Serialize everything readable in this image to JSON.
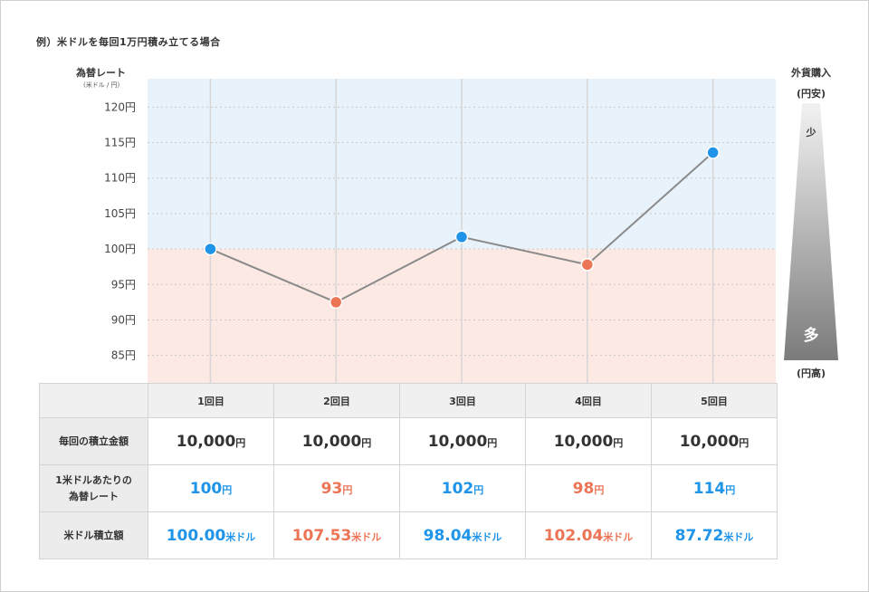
{
  "title": "例）米ドルを毎回1万円積み立てる場合",
  "y_axis": {
    "label": "為替レート",
    "unit": "(米ドル / 円)"
  },
  "meter": {
    "title": "外貨購入",
    "top_label": "(円安)",
    "bottom_label": "(円高)",
    "small_word": "少",
    "big_word": "多"
  },
  "colors": {
    "blue": "#1f94e8",
    "red": "#ec7556",
    "band_blue": "#e8f2fb",
    "band_red": "#fce9e3",
    "line": "#8a8a8a"
  },
  "chart_data": {
    "type": "line",
    "x": [
      "1回目",
      "2回目",
      "3回目",
      "4回目",
      "5回目"
    ],
    "series": [
      {
        "values": [
          100,
          92.5,
          101.7,
          97.8,
          113.6
        ]
      }
    ],
    "y_ticks": [
      "120円",
      "115円",
      "110円",
      "105円",
      "100円",
      "95円",
      "90円",
      "85円"
    ],
    "ylim": [
      81,
      124
    ],
    "threshold": 100,
    "point_colors": [
      "blue",
      "red",
      "blue",
      "red",
      "blue"
    ],
    "grid": true,
    "xlabel": "",
    "ylabel": "為替レート"
  },
  "table": {
    "columns": [
      "1回目",
      "2回目",
      "3回目",
      "4回目",
      "5回目"
    ],
    "rows": [
      {
        "label_lines": [
          "毎回の積立金額"
        ],
        "cells": [
          {
            "value": "10,000",
            "unit": "円"
          },
          {
            "value": "10,000",
            "unit": "円"
          },
          {
            "value": "10,000",
            "unit": "円"
          },
          {
            "value": "10,000",
            "unit": "円"
          },
          {
            "value": "10,000",
            "unit": "円"
          }
        ]
      },
      {
        "label_lines": [
          "1米ドルあたりの",
          "為替レート"
        ],
        "cells": [
          {
            "value": "100",
            "unit": "円"
          },
          {
            "value": "93",
            "unit": "円"
          },
          {
            "value": "102",
            "unit": "円"
          },
          {
            "value": "98",
            "unit": "円"
          },
          {
            "value": "114",
            "unit": "円"
          }
        ]
      },
      {
        "label_lines": [
          "米ドル積立額"
        ],
        "cells": [
          {
            "value": "100.00",
            "unit": "米ドル"
          },
          {
            "value": "107.53",
            "unit": "米ドル"
          },
          {
            "value": "98.04",
            "unit": "米ドル"
          },
          {
            "value": "102.04",
            "unit": "米ドル"
          },
          {
            "value": "87.72",
            "unit": "米ドル"
          }
        ]
      }
    ]
  }
}
